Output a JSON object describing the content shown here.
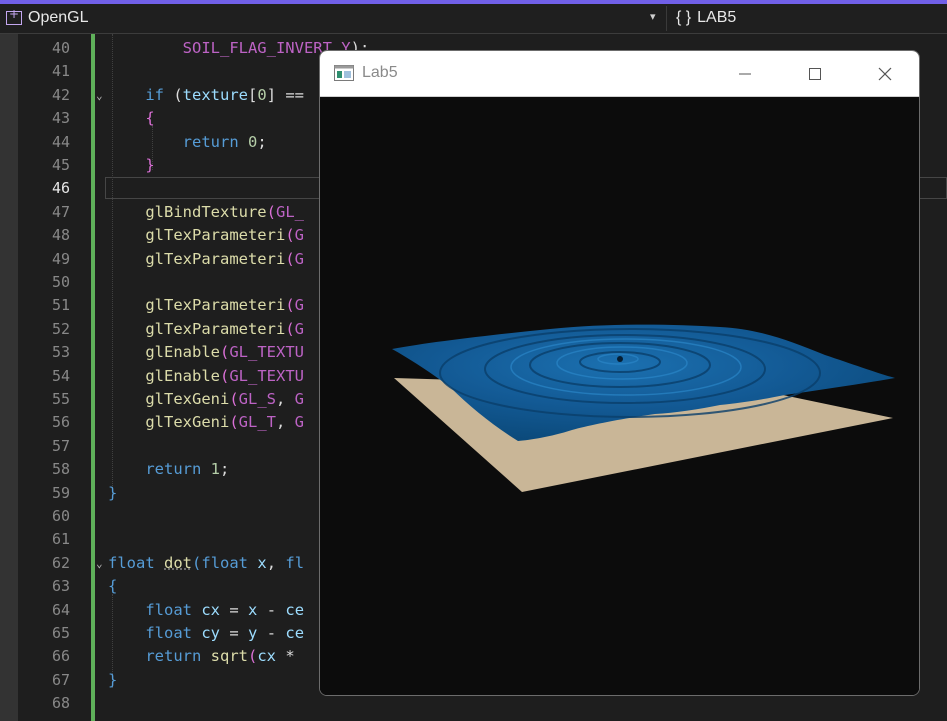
{
  "navbar": {
    "project": "OpenGL",
    "scope_icon": "{ }",
    "scope": "LAB5"
  },
  "editor": {
    "lines": [
      {
        "n": "40",
        "code": "        SOIL_FLAG_INVERT_Y);"
      },
      {
        "n": "41",
        "code": ""
      },
      {
        "n": "42",
        "code": "    if (texture[0] =="
      },
      {
        "n": "43",
        "code": "    {"
      },
      {
        "n": "44",
        "code": "        return 0;"
      },
      {
        "n": "45",
        "code": "    }"
      },
      {
        "n": "46",
        "code": ""
      },
      {
        "n": "47",
        "code": "    glBindTexture(GL_"
      },
      {
        "n": "48",
        "code": "    glTexParameteri(G"
      },
      {
        "n": "49",
        "code": "    glTexParameteri(G"
      },
      {
        "n": "50",
        "code": ""
      },
      {
        "n": "51",
        "code": "    glTexParameteri(G"
      },
      {
        "n": "52",
        "code": "    glTexParameteri(G"
      },
      {
        "n": "53",
        "code": "    glEnable(GL_TEXTU"
      },
      {
        "n": "54",
        "code": "    glEnable(GL_TEXTU"
      },
      {
        "n": "55",
        "code": "    glTexGeni(GL_S, G"
      },
      {
        "n": "56",
        "code": "    glTexGeni(GL_T, G"
      },
      {
        "n": "57",
        "code": ""
      },
      {
        "n": "58",
        "code": "    return 1;"
      },
      {
        "n": "59",
        "code": "}"
      },
      {
        "n": "60",
        "code": ""
      },
      {
        "n": "61",
        "code": ""
      },
      {
        "n": "62",
        "code": "float dot(float x, fl"
      },
      {
        "n": "63",
        "code": "{"
      },
      {
        "n": "64",
        "code": "    float cx = x - ce"
      },
      {
        "n": "65",
        "code": "    float cy = y - ce"
      },
      {
        "n": "66",
        "code": "    return sqrt(cx *"
      },
      {
        "n": "67",
        "code": "}"
      },
      {
        "n": "68",
        "code": ""
      }
    ]
  },
  "window": {
    "title": "Lab5",
    "icon": "app-window-icon",
    "controls": [
      "minimize-icon",
      "maximize-icon",
      "close-icon"
    ],
    "scene": {
      "water_color": "#0f5590",
      "floor_color": "#c9b697",
      "background": "#0c0c0c"
    }
  }
}
